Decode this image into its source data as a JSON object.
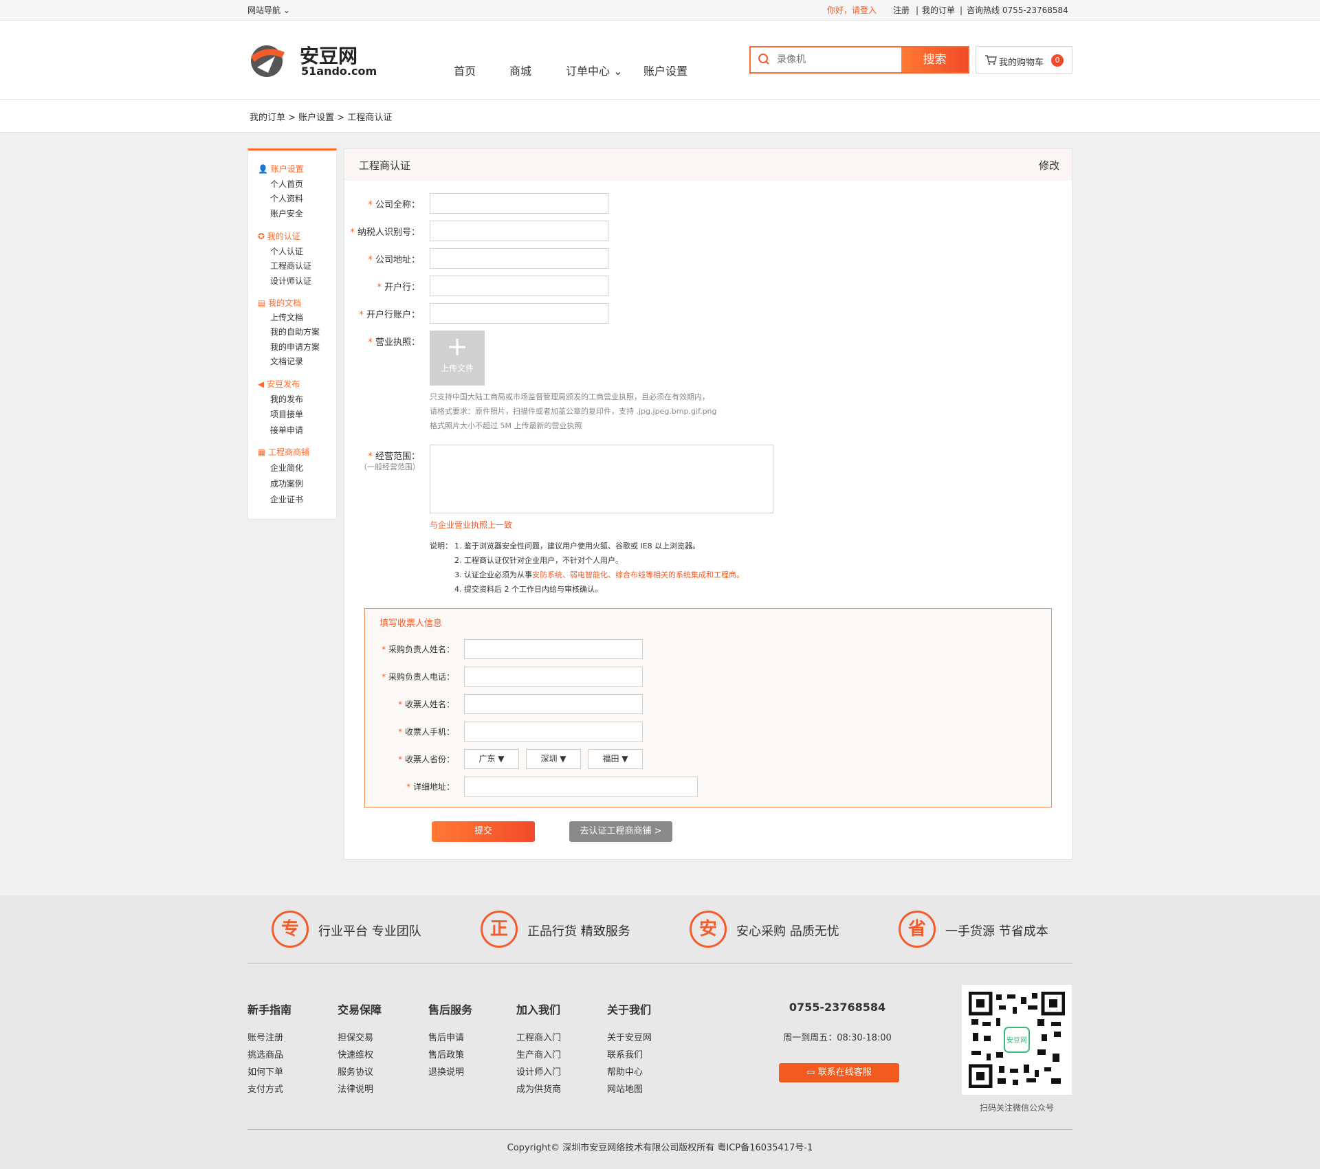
{
  "topbar": {
    "nav": "网站导航",
    "greeting": "你好，请登入",
    "register": "注册",
    "orders": "我的订单",
    "hotline": "咨询热线 0755-23768584"
  },
  "logo": {
    "cn": "安豆网",
    "en": "51ando.com"
  },
  "nav": {
    "home": "首页",
    "mall": "商城",
    "order_center": "订单中心",
    "account": "账户设置"
  },
  "search": {
    "placeholder": "录像机",
    "button": "搜索"
  },
  "cart": {
    "label": "我的购物车",
    "count": "0"
  },
  "breadcrumb": "我的订单 > 账户设置 > 工程商认证",
  "sidebar": [
    {
      "group": "账户设置",
      "items": [
        "个人首页",
        "个人资料",
        "账户安全"
      ]
    },
    {
      "group": "我的认证",
      "items": [
        "个人认证",
        "工程商认证",
        "设计师认证"
      ]
    },
    {
      "group": "我的文档",
      "items": [
        "上传文档",
        "我的自助方案",
        "我的申请方案",
        "文档记录"
      ]
    },
    {
      "group": "安豆发布",
      "items": [
        "我的发布",
        "项目接单",
        "接单申请"
      ]
    },
    {
      "group": "工程商商铺",
      "items": [
        "企业简化",
        "成功案例",
        "企业证书"
      ]
    }
  ],
  "form": {
    "title": "工程商认证",
    "edit": "修改",
    "company_name": "公司全称：",
    "tax_id": "纳税人识别号：",
    "address": "公司地址：",
    "bank": "开户行：",
    "bank_account": "开户行账户：",
    "license": "营业执照：",
    "upload": "上传文件",
    "license_note": [
      "只支持中国大陆工商局或市场监督管理局颁发的工商营业执照，且必须在有效期内，",
      "请格式要求：原件照片，扫描件或者加盖公章的复印件，支持 .jpg.jpeg.bmp.gif.png",
      "格式照片大小不超过 5M 上传最新的营业执照"
    ],
    "scope": "经营范围：",
    "scope_sub": "（一般经营范围）",
    "scope_hint": "与企业营业执照上一致",
    "explain_label": "说明：",
    "explain": [
      "1. 鉴于浏览器安全性问题，建议用户使用火狐、谷歌或 IE8 以上浏览器。",
      "2. 工程商认证仅针对企业用户，不针对个人用户。",
      "3. 认证企业必须为从事",
      "4. 提交资料后 2 个工作日内给与审核确认。"
    ],
    "explain3_orange": "安防系统、弱电智能化、综合布线等相关的系统集成和工程商。"
  },
  "invoice": {
    "title": "填写收票人信息",
    "buyer_name": "采购负责人姓名：",
    "buyer_phone": "采购负责人电话：",
    "receiver_name": "收票人姓名：",
    "receiver_mobile": "收票人手机：",
    "province": "收票人省份：",
    "detail": "详细地址：",
    "prov": "广东 ▼",
    "city": "深圳 ▼",
    "district": "福田 ▼"
  },
  "buttons": {
    "submit": "提交",
    "shop": "去认证工程商商铺 >"
  },
  "footer": {
    "features": [
      {
        "icon": "专",
        "text": "行业平台 专业团队"
      },
      {
        "icon": "正",
        "text": "正品行货 精致服务"
      },
      {
        "icon": "安",
        "text": "安心采购 品质无忧"
      },
      {
        "icon": "省",
        "text": "一手货源 节省成本"
      }
    ],
    "cols": [
      {
        "title": "新手指南",
        "links": [
          "账号注册",
          "挑选商品",
          "如何下单",
          "支付方式"
        ]
      },
      {
        "title": "交易保障",
        "links": [
          "担保交易",
          "快速维权",
          "服务协议",
          "法律说明"
        ]
      },
      {
        "title": "售后服务",
        "links": [
          "售后申请",
          "售后政策",
          "退换说明"
        ]
      },
      {
        "title": "加入我们",
        "links": [
          "工程商入门",
          "生产商入门",
          "设计师入门",
          "成为供货商"
        ]
      },
      {
        "title": "关于我们",
        "links": [
          "关于安豆网",
          "联系我们",
          "帮助中心",
          "网站地图"
        ]
      }
    ],
    "phone": "0755-23768584",
    "hours": "周一到周五：08:30-18:00",
    "service": "联系在线客服",
    "qr_caption": "扫码关注微信公众号",
    "copyright": "Copyright© 深圳市安豆网络技术有限公司版权所有 粤ICP备16035417号-1"
  }
}
